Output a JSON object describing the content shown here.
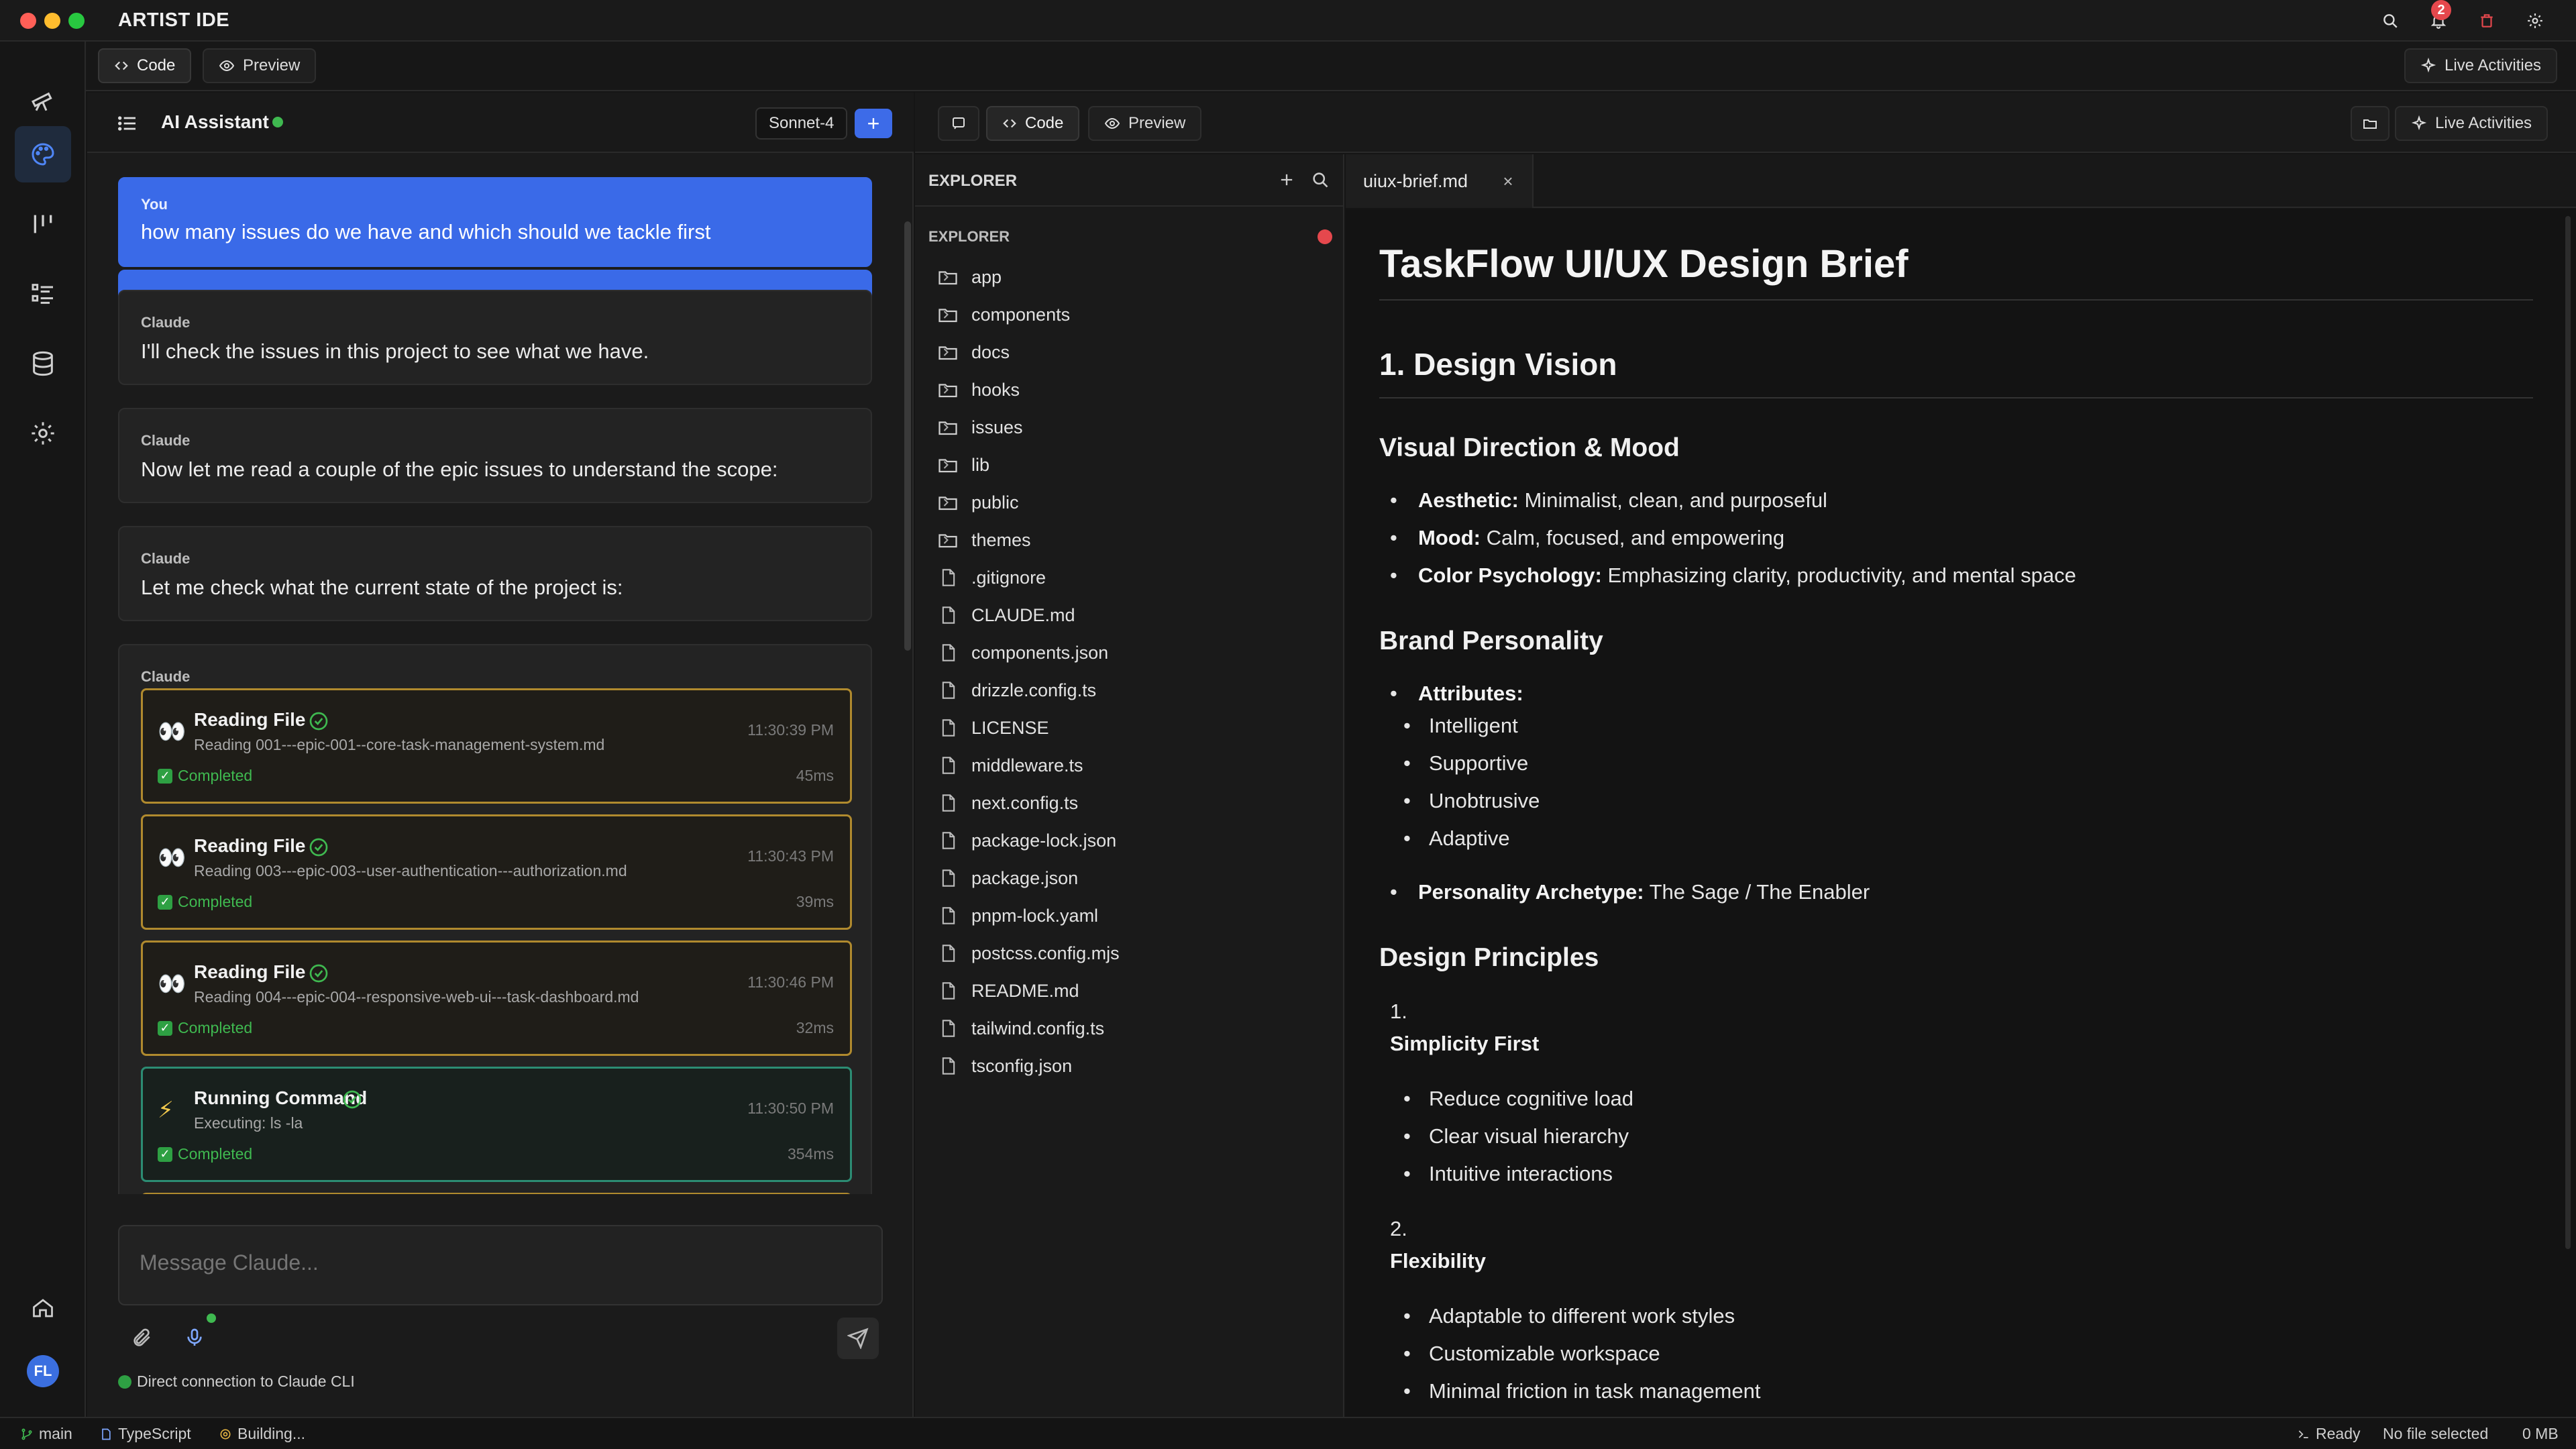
{
  "app": {
    "title": "ARTIST IDE"
  },
  "colors": {
    "accent": "#3a6ae8",
    "success": "#3fb950",
    "warning_border": "#b08a2e",
    "command_border": "#2c8c73",
    "danger": "#e5484d"
  },
  "titlebar": {
    "notification_count": "2"
  },
  "top_toolbar": {
    "code_label": "Code",
    "preview_label": "Preview",
    "live_activities_label": "Live Activities"
  },
  "assistant": {
    "title": "AI Assistant",
    "model": "Sonnet-4",
    "new_label": "+",
    "messages": [
      {
        "author": "You",
        "text": "how many issues do we have and which should we tackle first"
      },
      {
        "author": "Claude",
        "text": "I'll check the issues in this project to see what we have."
      },
      {
        "author": "Claude",
        "text": "Now let me read a couple of the epic issues to understand the scope:"
      },
      {
        "author": "Claude",
        "text": "Let me check what the current state of the project is:"
      },
      {
        "author": "Claude"
      }
    ],
    "tools": [
      {
        "icon": "eyes-icon",
        "glyph": "👀",
        "name": "Reading File",
        "detail": "Reading 001---epic-001--core-task-management-system.md",
        "time": "11:30:39 PM",
        "status": "Completed",
        "duration": "45ms"
      },
      {
        "icon": "eyes-icon",
        "glyph": "👀",
        "name": "Reading File",
        "detail": "Reading 003---epic-003--user-authentication---authorization.md",
        "time": "11:30:43 PM",
        "status": "Completed",
        "duration": "39ms"
      },
      {
        "icon": "eyes-icon",
        "glyph": "👀",
        "name": "Reading File",
        "detail": "Reading 004---epic-004--responsive-web-ui---task-dashboard.md",
        "time": "11:30:46 PM",
        "status": "Completed",
        "duration": "32ms"
      },
      {
        "icon": "lightning-icon",
        "glyph": "⚡",
        "name": "Running Command",
        "detail": "Executing: ls -la",
        "time": "11:30:50 PM",
        "status": "Completed",
        "duration": "354ms"
      }
    ],
    "composer": {
      "placeholder": "Message Claude..."
    },
    "connection_status": "Direct connection to Claude CLI"
  },
  "workspace": {
    "code_label": "Code",
    "preview_label": "Preview",
    "live_activities_label": "Live Activities"
  },
  "explorer": {
    "title": "EXPLORER",
    "subtitle": "EXPLORER",
    "folders": [
      "app",
      "components",
      "docs",
      "hooks",
      "issues",
      "lib",
      "public",
      "themes"
    ],
    "files": [
      ".gitignore",
      "CLAUDE.md",
      "components.json",
      "drizzle.config.ts",
      "LICENSE",
      "middleware.ts",
      "next.config.ts",
      "package-lock.json",
      "package.json",
      "pnpm-lock.yaml",
      "postcss.config.mjs",
      "README.md",
      "tailwind.config.ts",
      "tsconfig.json"
    ]
  },
  "editor": {
    "tab_label": "uiux-brief.md",
    "doc": {
      "title": "TaskFlow UI/UX Design Brief",
      "section1": "1. Design Vision",
      "visual_direction": {
        "heading": "Visual Direction & Mood",
        "items": [
          {
            "label": "Aesthetic:",
            "text": " Minimalist, clean, and purposeful"
          },
          {
            "label": "Mood:",
            "text": " Calm, focused, and empowering"
          },
          {
            "label": "Color Psychology:",
            "text": " Emphasizing clarity, productivity, and mental space"
          }
        ]
      },
      "brand": {
        "heading": "Brand Personality",
        "attributes_label": "Attributes:",
        "attributes": [
          "Intelligent",
          "Supportive",
          "Unobtrusive",
          "Adaptive"
        ],
        "archetype_label": "Personality Archetype:",
        "archetype_text": " The Sage / The Enabler"
      },
      "principles": {
        "heading": "Design Principles",
        "p1_num": "1.",
        "p1_title": "Simplicity First",
        "p1_items": [
          "Reduce cognitive load",
          "Clear visual hierarchy",
          "Intuitive interactions"
        ],
        "p2_num": "2.",
        "p2_title": "Flexibility",
        "p2_items": [
          "Adaptable to different work styles",
          "Customizable workspace",
          "Minimal friction in task management"
        ]
      }
    }
  },
  "statusbar": {
    "branch": "main",
    "language": "TypeScript",
    "build": "Building...",
    "terminal": "Ready",
    "selection": "No file selected",
    "size": "0 MB"
  }
}
